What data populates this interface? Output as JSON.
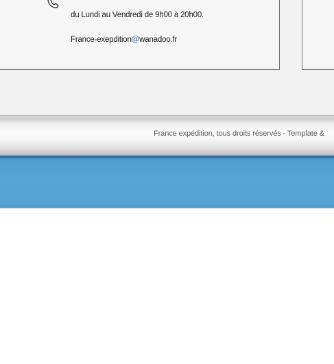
{
  "contact": {
    "hours": "du Lundi au Vendredi de 9h00 à 20h00.",
    "email_user": "France-exepdition",
    "email_at": "@",
    "email_domain": "wanadoo.fr",
    "icon": "phone-icon"
  },
  "footer": {
    "text": "France expédition, tous droits réservés - Template &"
  },
  "colors": {
    "footer_band": "#ececec",
    "blue_band": "#55a5d4",
    "link": "#2d62a8"
  }
}
